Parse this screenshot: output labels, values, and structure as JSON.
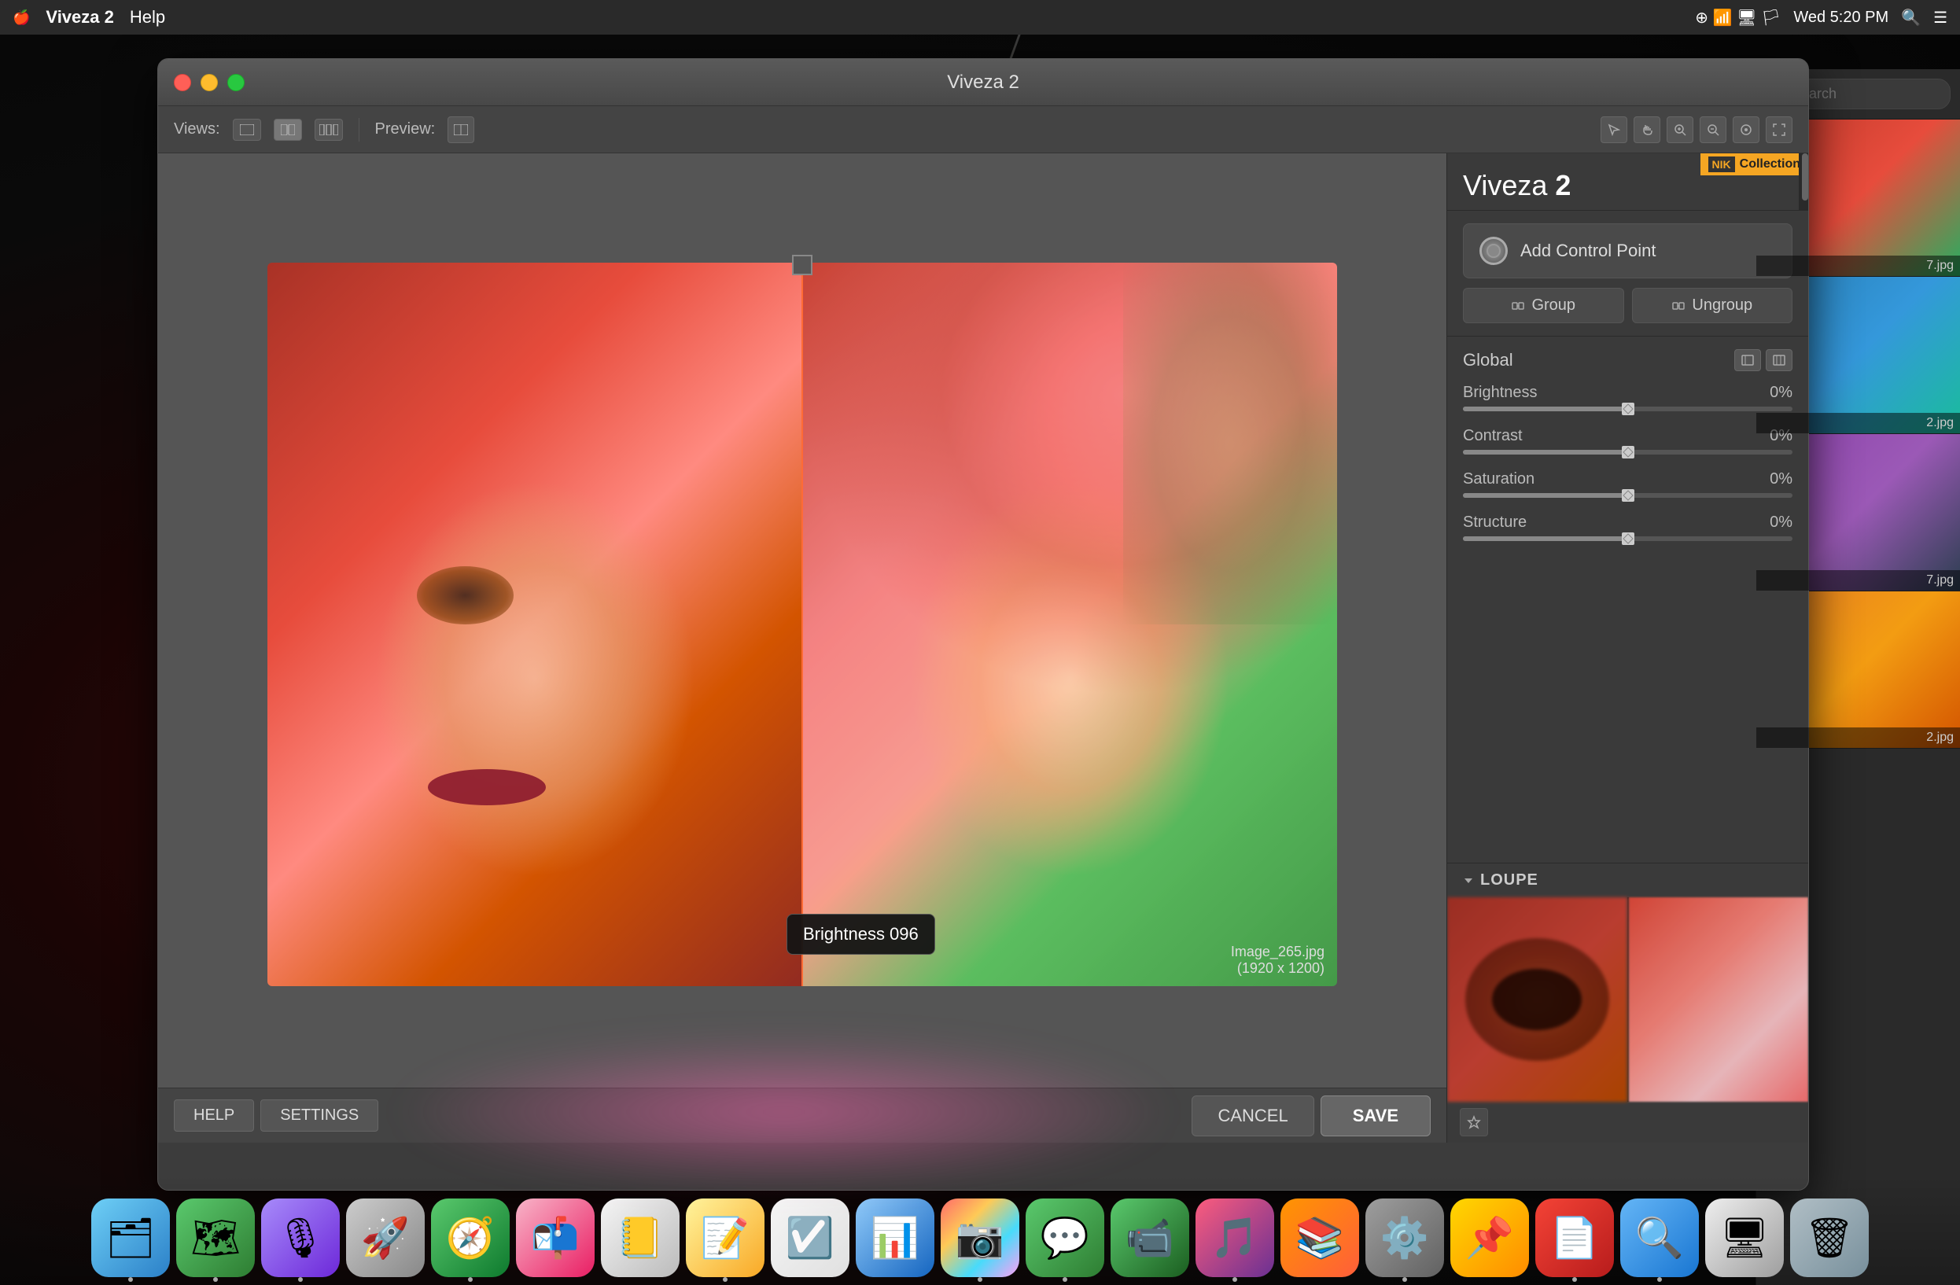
{
  "menubar": {
    "apple": "🍎",
    "app_name": "Viveza 2",
    "help": "Help",
    "time": "Wed 5:20 PM"
  },
  "window": {
    "title": "Viveza 2"
  },
  "toolbar": {
    "views_label": "Views:",
    "preview_label": "Preview:"
  },
  "panel": {
    "title_light": "Viveza ",
    "title_bold": "2",
    "nik_logo": "NIK",
    "nik_collection": "Collection",
    "add_control_point": "Add Control Point",
    "group": "Group",
    "ungroup": "Ungroup",
    "global_label": "Global",
    "brightness_label": "Brightness",
    "brightness_value": "0%",
    "contrast_label": "Contrast",
    "contrast_value": "0%",
    "saturation_label": "Saturation",
    "saturation_value": "0%",
    "structure_label": "Structure",
    "structure_value": "0%",
    "loupe_title": "LOUPE"
  },
  "image": {
    "filename": "Image_265.jpg",
    "dimensions": "(1920 x 1200)"
  },
  "bottom": {
    "help": "HELP",
    "settings": "SETTINGS",
    "cancel": "CANCEL",
    "save": "SAVE"
  },
  "filmstrip": {
    "search_placeholder": "Search",
    "files": [
      "7.jpg",
      "2.jpg",
      "7.jpg",
      "2.jpg"
    ]
  },
  "brightness_tooltip": {
    "label": "Brightness 096"
  },
  "dock": {
    "items": [
      {
        "name": "Finder",
        "emoji": "🗂"
      },
      {
        "name": "Maps",
        "emoji": "🗺"
      },
      {
        "name": "Siri",
        "emoji": "🎙"
      },
      {
        "name": "Rocket",
        "emoji": "🚀"
      },
      {
        "name": "Safari",
        "emoji": "🧭"
      },
      {
        "name": "SendLater",
        "emoji": "📬"
      },
      {
        "name": "Contacts",
        "emoji": "📒"
      },
      {
        "name": "Notes",
        "emoji": "📝"
      },
      {
        "name": "Reminders",
        "emoji": "☑️"
      },
      {
        "name": "Keynote",
        "emoji": "📊"
      },
      {
        "name": "Photos",
        "emoji": "📷"
      },
      {
        "name": "Messages",
        "emoji": "💬"
      },
      {
        "name": "FaceTime",
        "emoji": "📹"
      },
      {
        "name": "Music",
        "emoji": "🎵"
      },
      {
        "name": "Books",
        "emoji": "📚"
      },
      {
        "name": "SysPrefs",
        "emoji": "⚙️"
      },
      {
        "name": "Pasta",
        "emoji": "📌"
      },
      {
        "name": "Acrobat",
        "emoji": "📄"
      },
      {
        "name": "Capture",
        "emoji": "🔍"
      },
      {
        "name": "Finder2",
        "emoji": "🖥"
      },
      {
        "name": "Trash",
        "emoji": "🗑"
      }
    ]
  }
}
